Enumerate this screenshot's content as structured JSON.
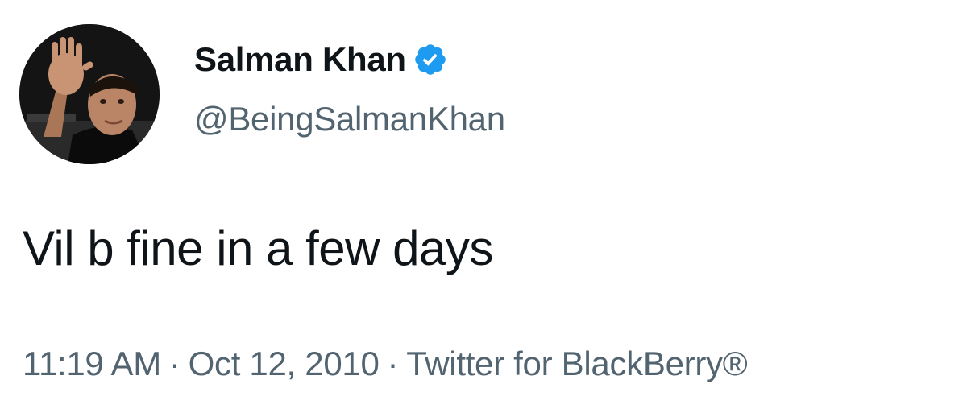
{
  "user": {
    "display_name": "Salman Khan",
    "handle": "@BeingSalmanKhan",
    "verified": true,
    "avatar_icon": "profile-photo",
    "verified_color": "#1d9bf0"
  },
  "tweet": {
    "text": "Vil b fine in a few days",
    "time": "11:19 AM",
    "separator": "·",
    "date": "Oct 12, 2010",
    "source": "Twitter for BlackBerry®"
  },
  "colors": {
    "primary_text": "#0f1419",
    "secondary_text": "#536471",
    "background": "#ffffff"
  }
}
